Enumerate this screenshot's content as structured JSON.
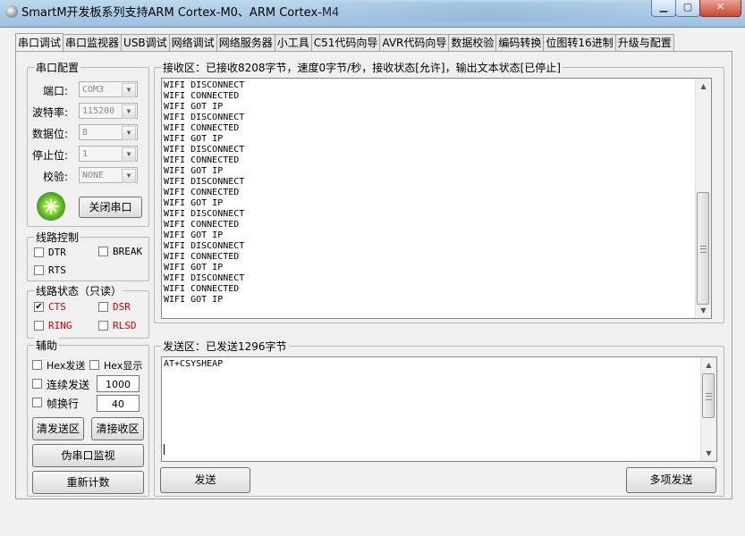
{
  "window": {
    "title": "SmartM开发板系列支持ARM Cortex-M0、ARM Cortex-M4",
    "min_icon": "minimize-icon",
    "max_icon": "maximize-icon",
    "close_icon": "close-icon"
  },
  "tabs": [
    "串口调试",
    "串口监视器",
    "USB调试",
    "网络调试",
    "网络服务器",
    "小工具",
    "C51代码向导",
    "AVR代码向导",
    "数据校验",
    "编码转换",
    "位图转16进制",
    "升级与配置"
  ],
  "serial_config": {
    "title": "串口配置",
    "port_label": "端口:",
    "port_value": "COM3",
    "baud_label": "波特率:",
    "baud_value": "115200",
    "databits_label": "数据位:",
    "databits_value": "8",
    "stopbits_label": "停止位:",
    "stopbits_value": "1",
    "parity_label": "校验:",
    "parity_value": "NONE",
    "close_port_button": "关闭串口",
    "status_color": "#5fc21a"
  },
  "line_control": {
    "title": "线路控制",
    "dtr": "DTR",
    "break": "BREAK",
    "rts": "RTS"
  },
  "line_status": {
    "title": "线路状态（只读）",
    "cts": "CTS",
    "dsr": "DSR",
    "ring": "RING",
    "rlsd": "RLSD",
    "cts_checked": true,
    "label_color": "#d00000"
  },
  "helper": {
    "title": "辅助",
    "hex_send": "Hex发送",
    "hex_display": "Hex显示",
    "continuous_send": "连续发送",
    "interval_value": "1000",
    "frame_newline": "帧换行",
    "frame_value": "40",
    "clear_send_button": "清发送区",
    "clear_receive_button": "清接收区",
    "pseudo_monitor_button": "伪串口监视",
    "reset_count_button": "重新计数"
  },
  "receive": {
    "title": "接收区：已接收8208字节，速度0字节/秒，接收状态[允许]，输出文本状态[已停止]",
    "lines": [
      "WIFI DISCONNECT",
      "WIFI CONNECTED",
      "WIFI GOT IP",
      "WIFI DISCONNECT",
      "WIFI CONNECTED",
      "WIFI GOT IP",
      "WIFI DISCONNECT",
      "WIFI CONNECTED",
      "WIFI GOT IP",
      "WIFI DISCONNECT",
      "WIFI CONNECTED",
      "WIFI GOT IP",
      "WIFI DISCONNECT",
      "WIFI CONNECTED",
      "WIFI GOT IP",
      "WIFI DISCONNECT",
      "WIFI CONNECTED",
      "WIFI GOT IP",
      "WIFI DISCONNECT",
      "WIFI CONNECTED",
      "WIFI GOT IP"
    ]
  },
  "send": {
    "title": "发送区：已发送1296字节",
    "text": "AT+CSYSHEAP",
    "send_button": "发送",
    "multi_send_button": "多项发送"
  }
}
